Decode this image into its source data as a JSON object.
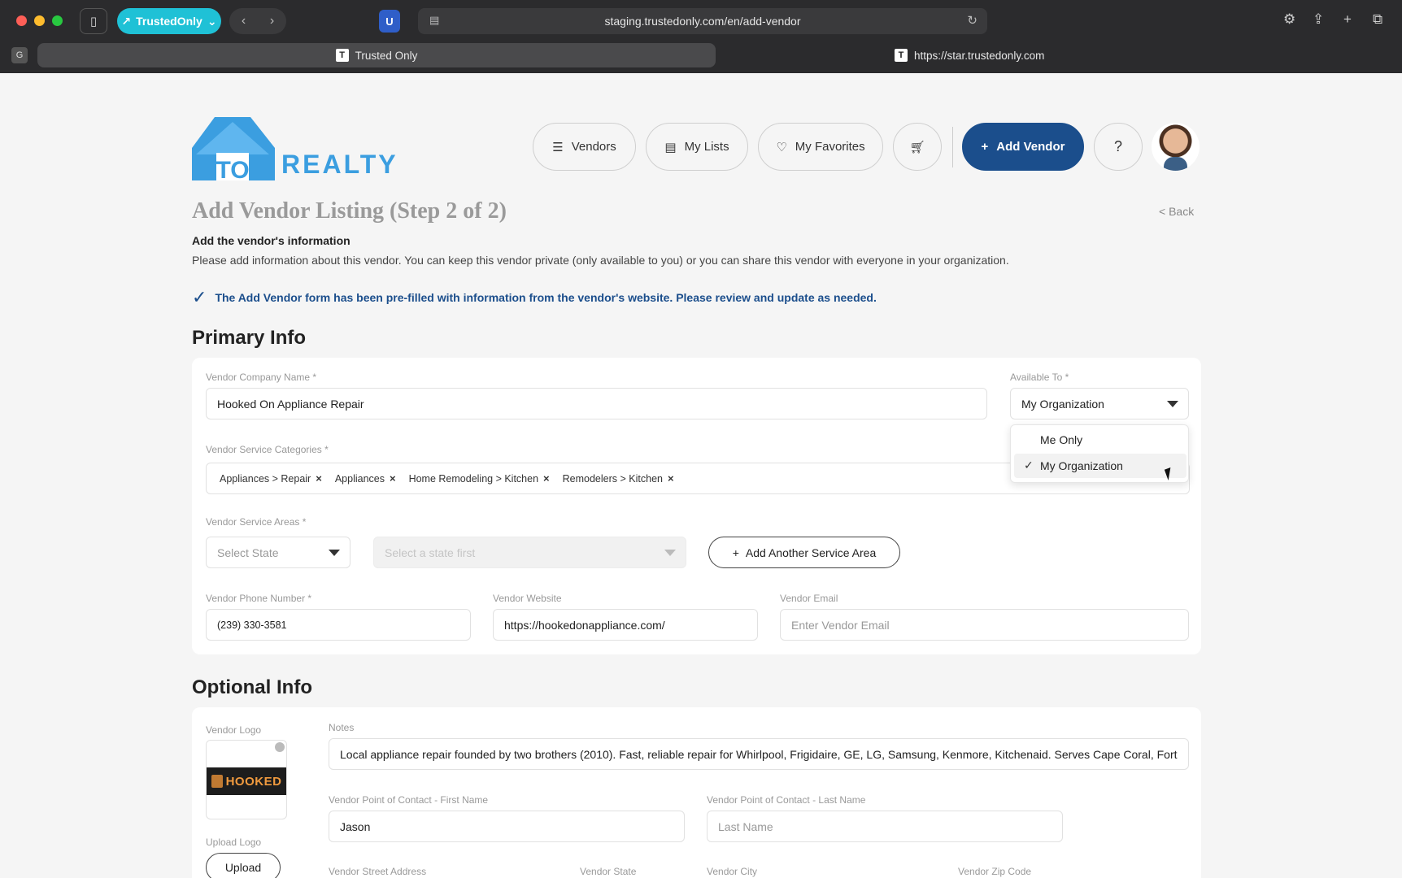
{
  "browser": {
    "extension_label": "TrustedOnly",
    "url": "staging.trustedonly.com/en/add-vendor",
    "tabs": [
      {
        "label": "Trusted Only",
        "favicon": "T"
      },
      {
        "label": "https://star.trustedonly.com",
        "favicon": "T"
      }
    ],
    "tab_group_label": "G"
  },
  "brand": {
    "logo_text": "TO REALTY",
    "accent": "#1b4e8c",
    "logo_blue": "#3b9ee0"
  },
  "nav": {
    "vendors": "Vendors",
    "my_lists": "My Lists",
    "my_favorites": "My Favorites",
    "add_vendor": "Add Vendor",
    "help": "?"
  },
  "page": {
    "title": "Add Vendor Listing (Step 2 of 2)",
    "back": "< Back",
    "subheading": "Add the vendor's information",
    "description": "Please add information about this vendor. You can keep this vendor private (only available to you) or you can share this vendor with everyone in your organization.",
    "notice": "The Add Vendor form has been pre-filled with information from the vendor's website. Please review and update as needed."
  },
  "primary": {
    "heading": "Primary Info",
    "company_label": "Vendor Company Name *",
    "company_value": "Hooked On Appliance Repair",
    "available_label": "Available To *",
    "available_value": "My Organization",
    "available_options": [
      "Me Only",
      "My Organization"
    ],
    "categories_label": "Vendor Service Categories *",
    "categories": [
      "Appliances > Repair",
      "Appliances",
      "Home Remodeling > Kitchen",
      "Remodelers > Kitchen"
    ],
    "areas_label": "Vendor Service Areas *",
    "state_placeholder": "Select State",
    "city_placeholder": "Select a state first",
    "add_area": "Add Another Service Area",
    "phone_label": "Vendor Phone Number  *",
    "phone_value": "(239) 330-3581",
    "website_label": "Vendor Website",
    "website_value": "https://hookedonappliance.com/",
    "email_label": "Vendor Email",
    "email_placeholder": "Enter Vendor Email"
  },
  "optional": {
    "heading": "Optional Info",
    "logo_label": "Vendor Logo",
    "logo_text": "HOOKED",
    "upload_label": "Upload Logo",
    "upload_button": "Upload",
    "notes_label": "Notes",
    "notes_value": "Local appliance repair founded by two brothers (2010). Fast, reliable repair for Whirlpool, Frigidaire, GE, LG, Samsung, Kenmore, Kitchenaid. Serves Cape Coral, Fort",
    "first_name_label": "Vendor Point of Contact - First Name",
    "first_name_value": "Jason",
    "last_name_label": "Vendor Point of Contact - Last Name",
    "last_name_placeholder": "Last Name",
    "street_label": "Vendor Street Address",
    "state_label": "Vendor State",
    "city_label": "Vendor City",
    "zip_label": "Vendor Zip Code"
  }
}
